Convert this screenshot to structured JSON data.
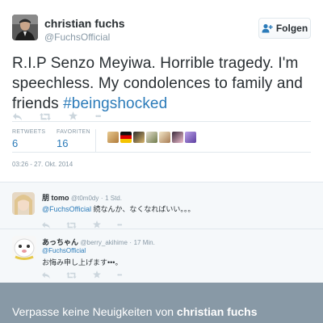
{
  "author": {
    "name": "christian fuchs",
    "handle": "@FuchsOfficial"
  },
  "follow_button": {
    "label": "Folgen",
    "icon": "follow-person-plus-icon"
  },
  "tweet": {
    "text": "R.I.P Senzo Meyiwa. Horrible tragedy. I'm speechless. My condolences to family and friends",
    "hashtag": "#beingshocked",
    "timestamp": "03:26 - 27. Okt. 2014"
  },
  "stats": {
    "retweets_label": "RETWEETS",
    "retweets_value": "6",
    "favorites_label": "FAVORITEN",
    "favorites_value": "16"
  },
  "actions": {
    "reply_icon": "reply-icon",
    "retweet_icon": "retweet-icon",
    "favorite_icon": "star-icon",
    "more_icon": "more-icon",
    "more_glyph": "•••"
  },
  "replies": [
    {
      "name": "朋 tomo",
      "handle": "@t0m0dy",
      "time": "1 Std.",
      "mention": "@FuchsOfficial",
      "text": "続なんか、なくなればいい。。。"
    },
    {
      "name": "あっちゃん",
      "handle": "@berry_akihime",
      "time": "17 Min.",
      "mention": "@FuchsOfficial",
      "text": "お悔み申し上げます•••。"
    }
  ],
  "banner": {
    "prefix": "Verpasse keine Neuigkeiten von",
    "name": "christian fuchs"
  },
  "colors": {
    "link": "#2b7bb9",
    "muted": "#8899a6",
    "banner_bg": "#8899a6",
    "replies_bg": "#f5f8fa"
  }
}
